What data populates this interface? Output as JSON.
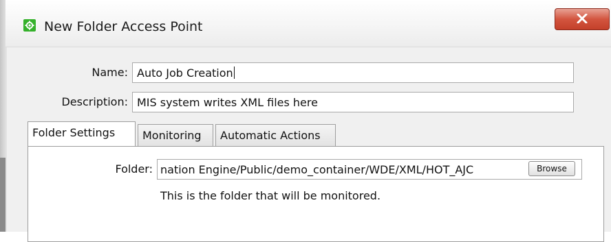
{
  "window": {
    "title": "New Folder Access Point",
    "icon": "gear-icon",
    "close_icon": "close-icon",
    "accent_color": "#35b12b",
    "close_color": "#c4402a"
  },
  "form": {
    "name_label": "Name:",
    "name_value": "Auto Job Creation",
    "description_label": "Description:",
    "description_value": "MIS system writes XML files here"
  },
  "tabs": [
    {
      "label": "Folder Settings",
      "active": true
    },
    {
      "label": "Monitoring",
      "active": false
    },
    {
      "label": "Automatic Actions",
      "active": false
    }
  ],
  "folder_settings": {
    "folder_label": "Folder:",
    "folder_value": "nation Engine/Public/demo_container/WDE/XML/HOT_AJC",
    "browse_label": "Browse",
    "hint": "This is the folder that will be monitored."
  }
}
